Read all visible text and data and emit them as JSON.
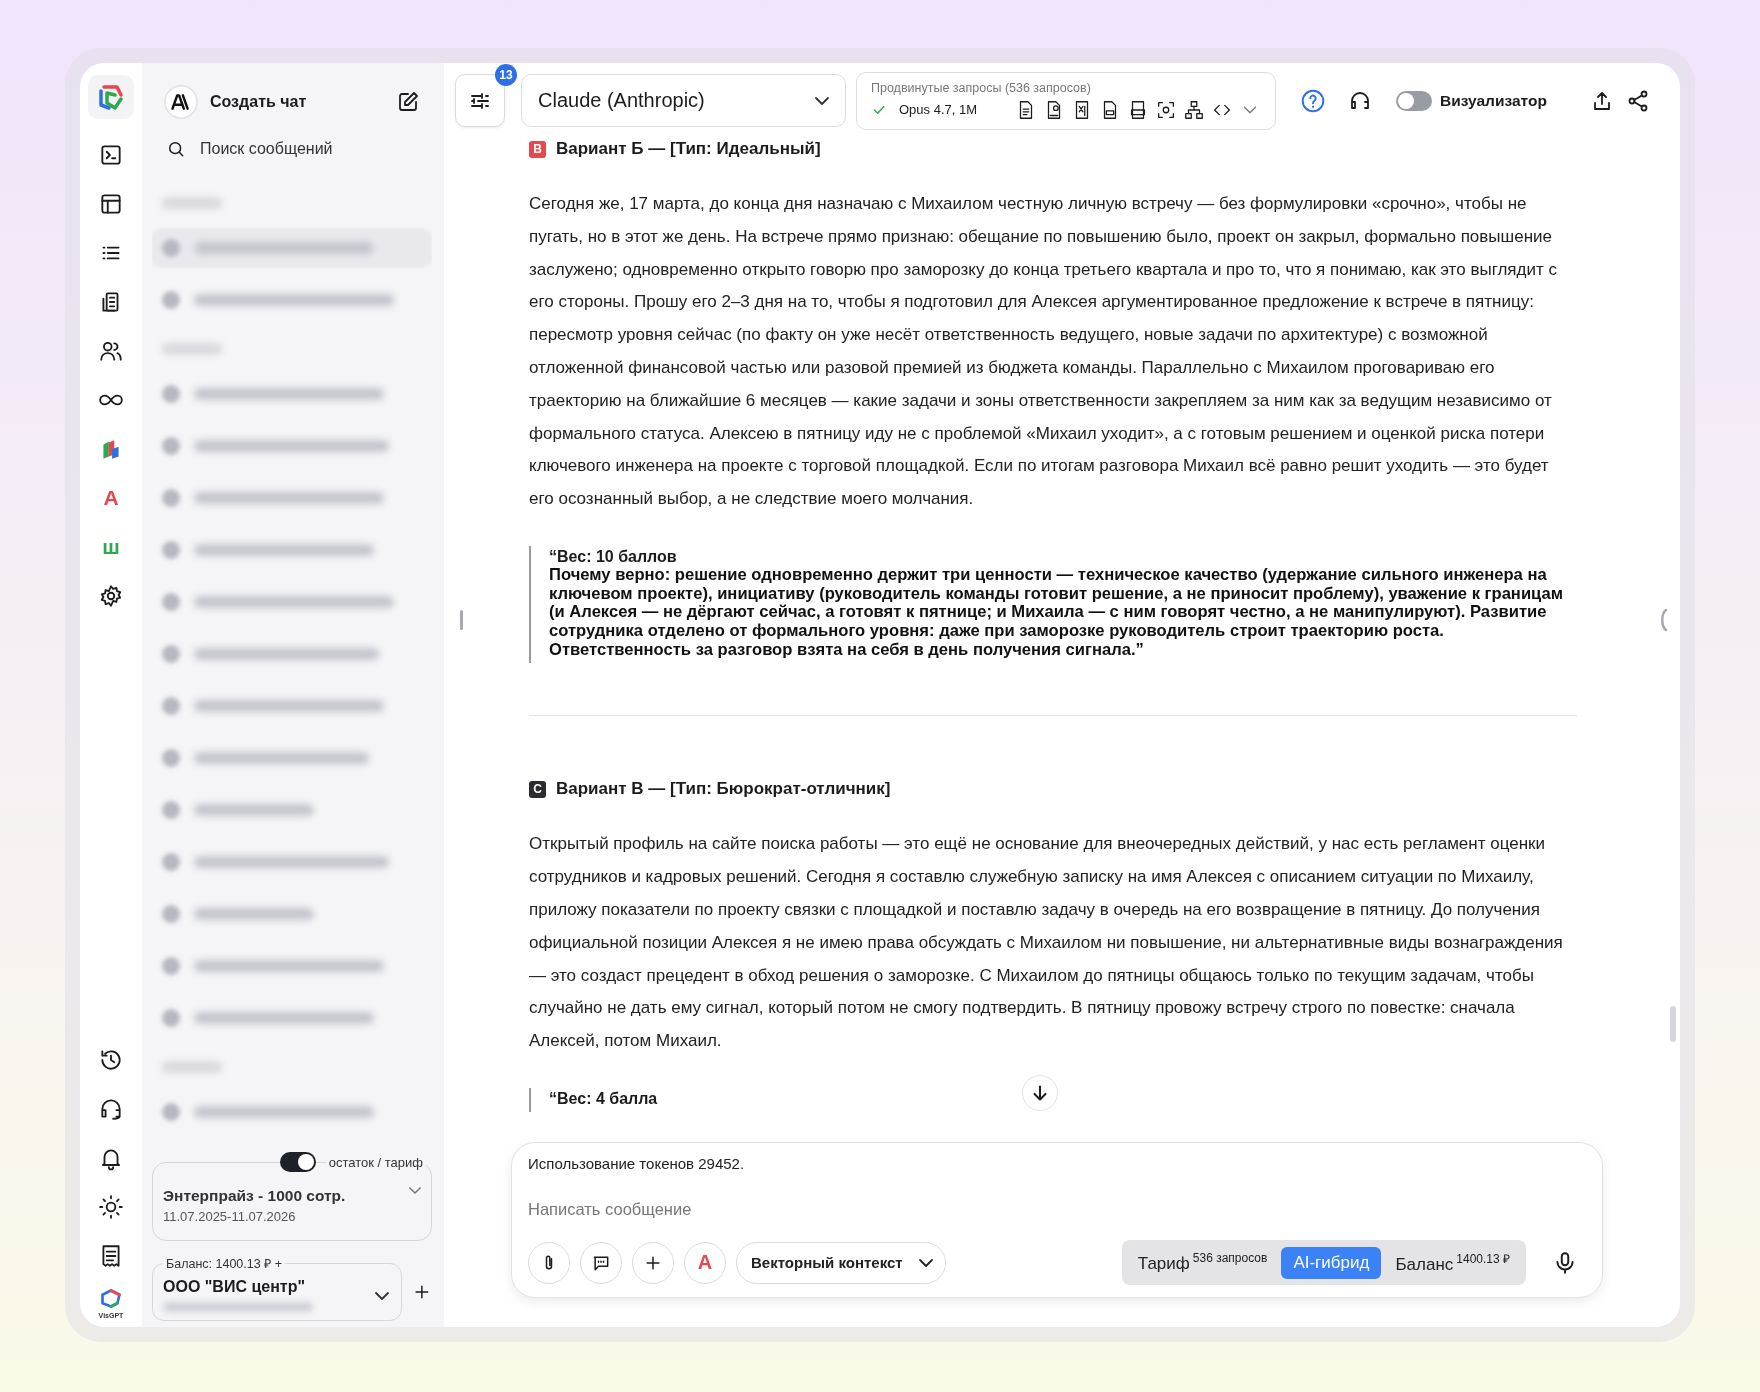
{
  "rail": {
    "glyph_icons": [
      {
        "char": "A",
        "color": "#e5484d"
      },
      {
        "char": "ш",
        "color": "#2fa84f"
      }
    ],
    "logo_caption": "VisGPT"
  },
  "sidebar": {
    "new_chat": "Создать чат",
    "search_placeholder": "Поиск сообщений",
    "plan_toggle": {
      "label": "остаток / тариф",
      "on": true
    },
    "plan": {
      "name": "Энтерпрайз - 1000 сотр.",
      "dates": "11.07.2025-11.07.2026"
    },
    "balance": {
      "label": "Баланс: 1400.13 ₽ +",
      "org": "ООО \"ВИС центр\""
    }
  },
  "toolbar": {
    "badge": "13",
    "model": "Claude (Anthropic)",
    "advanced": {
      "title": "Продвинутые запросы (536 запросов)",
      "model": "Opus 4.7, 1M"
    },
    "visualizer": {
      "label": "Визуализатор",
      "on": false
    }
  },
  "messages": [
    {
      "kind": "heading",
      "badge": "B",
      "color": "#e5484d",
      "text": "Вариант Б — [Тип: Идеальный]"
    },
    {
      "kind": "paragraph",
      "text": "Сегодня же, 17 марта, до конца дня назначаю с Михаилом честную личную встречу — без формулировки «срочно», чтобы не пугать, но в этот же день. На встрече прямо признаю: обещание по повышению было, проект он закрыл, формально повышение заслужено; одновременно открыто говорю про заморозку до конца третьего квартала и про то, что я понимаю, как это выглядит с его стороны. Прошу его 2–3 дня на то, чтобы я подготовил для Алексея аргументированное предложение к встрече в пятницу: пересмотр уровня сейчас (по факту он уже несёт ответственность ведущего, новые задачи по архитектуре) с возможной отложенной финансовой частью или разовой премией из бюджета команды. Параллельно с Михаилом проговариваю его траекторию на ближайшие 6 месяцев — какие задачи и зоны ответственности закрепляем за ним как за ведущим независимо от формального статуса. Алексею в пятницу иду не с проблемой «Михаил уходит», а с готовым решением и оценкой риска потери ключевого инженера на проекте с торговой площадкой. Если по итогам разговора Михаил всё равно решит уходить — это будет его осознанный выбор, а не следствие моего молчания."
    },
    {
      "kind": "quote",
      "title": "“Вес: 10 баллов",
      "text": "**Почему верно:** решение одновременно держит три ценности — техническое качество (удержание сильного инженера на ключевом проекте), инициативу (руководитель команды готовит решение, а не приносит проблему), уважение к границам (и Алексея — не дёргают сейчас, а готовят к пятнице; и Михаила — с ним говорят честно, а не манипулируют). Развитие сотрудника отделено от формального уровня: даже при заморозке руководитель строит траекторию роста. Ответственность за разговор взята на себя в день получения сигнала.”"
    },
    {
      "kind": "divider"
    },
    {
      "kind": "heading",
      "badge": "C",
      "color": "#2b2b30",
      "text": "Вариант В — [Тип: Бюрократ-отличник]"
    },
    {
      "kind": "paragraph",
      "text": "Открытый профиль на сайте поиска работы — это ещё не основание для внеочередных действий, у нас есть регламент оценки сотрудников и кадровых решений. Сегодня я составлю служебную записку на имя Алексея с описанием ситуации по Михаилу, приложу показатели по проекту связки с площадкой и поставлю задачу в очередь на его возвращение в пятницу. До получения официальной позиции Алексея я не имею права обсуждать с Михаилом ни повышение, ни альтернативные виды вознаграждения — это создаст прецедент в обход решения о заморозке. С Михаилом до пятницы общаюсь только по текущим задачам, чтобы случайно не дать ему сигнал, который потом не смогу подтвердить. В пятницу провожу встречу строго по повестке: сначала Алексей, потом Михаил."
    },
    {
      "kind": "quote",
      "title": "“Вес: 4 балла"
    }
  ],
  "composer": {
    "token_usage": "Использование токенов 29452.",
    "placeholder": "Написать сообщение",
    "persona_glyph": "A",
    "context_button": "Векторный контекст",
    "modes": [
      {
        "label": "Тариф",
        "note": "536 запросов",
        "selected": false
      },
      {
        "label": "AI-гибрид",
        "selected": true
      },
      {
        "label": "Баланс",
        "note": "1400.13 ₽",
        "selected": false
      }
    ]
  }
}
